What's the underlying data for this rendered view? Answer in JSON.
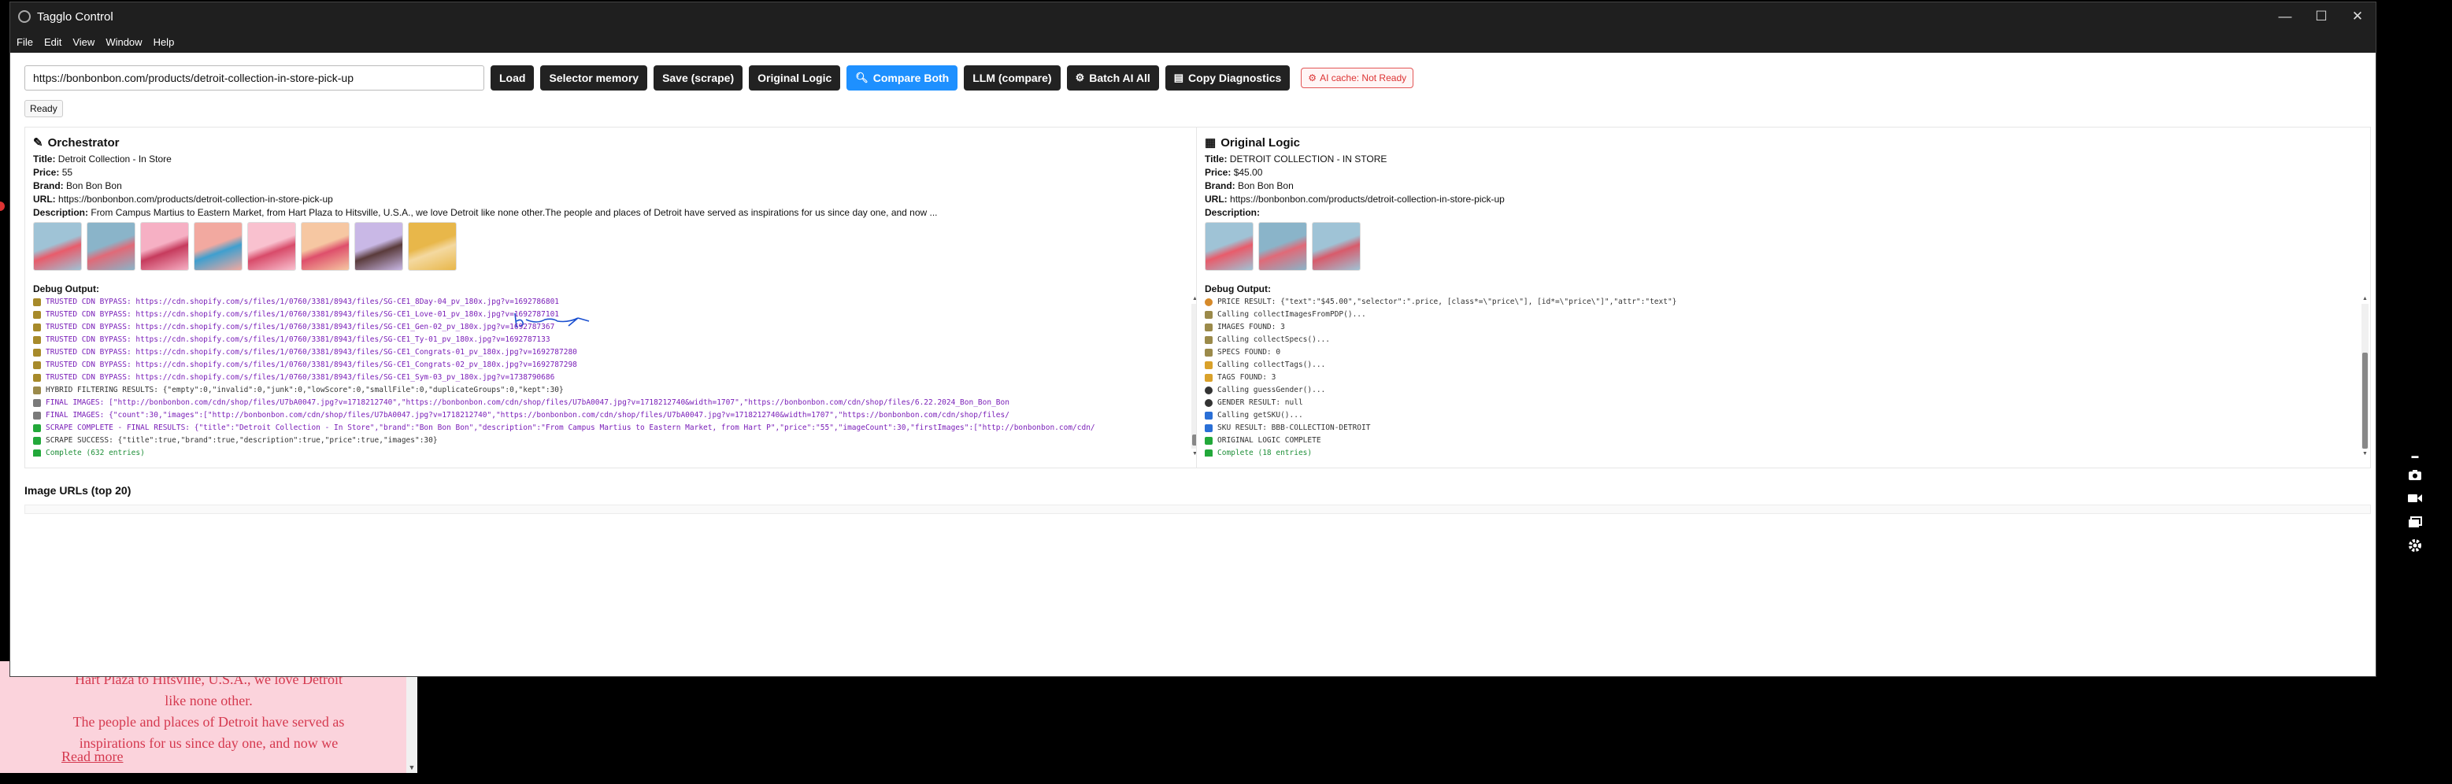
{
  "window": {
    "title": "Tagglo Control",
    "controls": {
      "minimize": "—",
      "maximize": "☐",
      "close": "✕"
    }
  },
  "menu": [
    "File",
    "Edit",
    "View",
    "Window",
    "Help"
  ],
  "toolbar": {
    "url_value": "https://bonbonbon.com/products/detroit-collection-in-store-pick-up",
    "buttons": {
      "load": "Load",
      "selector_memory": "Selector memory",
      "save_scrape": "Save (scrape)",
      "original_logic": "Original Logic",
      "compare_both": "Compare Both",
      "llm_compare": "LLM (compare)",
      "batch_ai_all": "Batch AI All",
      "copy_diagnostics": "Copy Diagnostics"
    },
    "ai_cache": "AI cache: Not Ready",
    "accent": "#1e90ff"
  },
  "status": "Ready",
  "left_panel": {
    "title": "Orchestrator",
    "fields": {
      "title_label": "Title:",
      "title": "Detroit Collection - In Store",
      "price_label": "Price:",
      "price": "55",
      "brand_label": "Brand:",
      "brand": "Bon Bon Bon",
      "url_label": "URL:",
      "url": "https://bonbonbon.com/products/detroit-collection-in-store-pick-up",
      "description_label": "Description:",
      "description": "From Campus Martius to Eastern Market, from Hart Plaza to Hitsville, U.S.A., we love Detroit like none other.The people and places of Detroit have served as inspirations for us since day one, and now ..."
    },
    "thumbnail_colors": [
      [
        "#9fc3d6",
        "#e85c6b"
      ],
      [
        "#8ab4c9",
        "#e06a78"
      ],
      [
        "#f6b0c4",
        "#c63b5d"
      ],
      [
        "#f2a9a0",
        "#3f9fcf"
      ],
      [
        "#f9c1cf",
        "#d84b6a"
      ],
      [
        "#f6c7a2",
        "#de4f6b"
      ],
      [
        "#c9b8e6",
        "#5a3b3b"
      ],
      [
        "#e8b74a",
        "#f4d9a0"
      ]
    ],
    "debug_label": "Debug Output:",
    "debug_lines": [
      {
        "icon": "lock",
        "style": "purple",
        "text": "TRUSTED CDN BYPASS: https://cdn.shopify.com/s/files/1/0760/3381/8943/files/SG-CE1_8Day-04_pv_180x.jpg?v=1692786801"
      },
      {
        "icon": "lock",
        "style": "purple",
        "text": "TRUSTED CDN BYPASS: https://cdn.shopify.com/s/files/1/0760/3381/8943/files/SG-CE1_Love-01_pv_180x.jpg?v=1692787101"
      },
      {
        "icon": "lock",
        "style": "purple",
        "text": "TRUSTED CDN BYPASS: https://cdn.shopify.com/s/files/1/0760/3381/8943/files/SG-CE1_Gen-02_pv_180x.jpg?v=1692787367"
      },
      {
        "icon": "lock",
        "style": "purple",
        "text": "TRUSTED CDN BYPASS: https://cdn.shopify.com/s/files/1/0760/3381/8943/files/SG-CE1_Ty-01_pv_180x.jpg?v=1692787133"
      },
      {
        "icon": "lock",
        "style": "purple",
        "text": "TRUSTED CDN BYPASS: https://cdn.shopify.com/s/files/1/0760/3381/8943/files/SG-CE1_Congrats-01_pv_180x.jpg?v=1692787280"
      },
      {
        "icon": "lock",
        "style": "purple",
        "text": "TRUSTED CDN BYPASS: https://cdn.shopify.com/s/files/1/0760/3381/8943/files/SG-CE1_Congrats-02_pv_180x.jpg?v=1692787298"
      },
      {
        "icon": "lock",
        "style": "purple",
        "text": "TRUSTED CDN BYPASS: https://cdn.shopify.com/s/files/1/0760/3381/8943/files/SG-CE1_Sym-03_pv_180x.jpg?v=1738790686"
      },
      {
        "icon": "hyb",
        "style": "dark",
        "text": "HYBRID FILTERING RESULTS: {\"empty\":0,\"invalid\":0,\"junk\":0,\"lowScore\":0,\"smallFile\":0,\"duplicateGroups\":0,\"kept\":30}"
      },
      {
        "icon": "fin",
        "style": "purple",
        "text": "FINAL IMAGES: [\"http://bonbonbon.com/cdn/shop/files/U7bA0047.jpg?v=1718212740\",\"https://bonbonbon.com/cdn/shop/files/U7bA0047.jpg?v=1718212740&width=1707\",\"https://bonbonbon.com/cdn/shop/files/6.22.2024_Bon_Bon_Bon"
      },
      {
        "icon": "fin",
        "style": "purple",
        "text": "FINAL IMAGES: {\"count\":30,\"images\":[\"http://bonbonbon.com/cdn/shop/files/U7bA0047.jpg?v=1718212740\",\"https://bonbonbon.com/cdn/shop/files/U7bA0047.jpg?v=1718212740&width=1707\",\"https://bonbonbon.com/cdn/shop/files/"
      },
      {
        "icon": "ok",
        "style": "purple",
        "text": "SCRAPE COMPLETE - FINAL RESULTS: {\"title\":\"Detroit Collection - In Store\",\"brand\":\"Bon Bon Bon\",\"description\":\"From Campus Martius to Eastern Market, from Hart P\",\"price\":\"55\",\"imageCount\":30,\"firstImages\":[\"http://bonbonbon.com/cdn/"
      },
      {
        "icon": "ok",
        "style": "dark",
        "text": "SCRAPE SUCCESS: {\"title\":true,\"brand\":true,\"description\":true,\"price\":true,\"images\":30}"
      },
      {
        "icon": "ok",
        "style": "green",
        "text": "Complete (632 entries)"
      }
    ]
  },
  "right_panel": {
    "title": "Original Logic",
    "fields": {
      "title_label": "Title:",
      "title": "DETROIT COLLECTION - IN STORE",
      "price_label": "Price:",
      "price": "$45.00",
      "brand_label": "Brand:",
      "brand": "Bon Bon Bon",
      "url_label": "URL:",
      "url": "https://bonbonbon.com/products/detroit-collection-in-store-pick-up",
      "description_label": "Description:",
      "description": ""
    },
    "thumbnail_colors": [
      [
        "#9fc3d6",
        "#e85c6b"
      ],
      [
        "#8ab4c9",
        "#e06a78"
      ],
      [
        "#9fc3d6",
        "#d85b6b"
      ]
    ],
    "debug_label": "Debug Output:",
    "debug_lines": [
      {
        "icon": "price",
        "style": "dark",
        "text": "PRICE RESULT: {\"text\":\"$45.00\",\"selector\":\".price, [class*=\\\"price\\\"], [id*=\\\"price\\\"]\",\"attr\":\"text\"}"
      },
      {
        "icon": "hyb",
        "style": "dark",
        "text": "Calling collectImagesFromPDP()..."
      },
      {
        "icon": "hyb",
        "style": "dark",
        "text": "IMAGES FOUND: 3"
      },
      {
        "icon": "hyb",
        "style": "dark",
        "text": "Calling collectSpecs()..."
      },
      {
        "icon": "hyb",
        "style": "dark",
        "text": "SPECS FOUND: 0"
      },
      {
        "icon": "tag",
        "style": "dark",
        "text": "Calling collectTags()..."
      },
      {
        "icon": "tag",
        "style": "dark",
        "text": "TAGS FOUND: 3"
      },
      {
        "icon": "person",
        "style": "dark",
        "text": "Calling guessGender()..."
      },
      {
        "icon": "person",
        "style": "dark",
        "text": "GENDER RESULT: null"
      },
      {
        "icon": "blue",
        "style": "dark",
        "text": "Calling getSKU()..."
      },
      {
        "icon": "blue",
        "style": "dark",
        "text": "SKU RESULT: BBB-COLLECTION-DETROIT"
      },
      {
        "icon": "ok",
        "style": "dark",
        "text": "ORIGINAL LOGIC COMPLETE"
      },
      {
        "icon": "ok",
        "style": "green",
        "text": "Complete (18 entries)"
      }
    ]
  },
  "image_urls_heading": "Image URLs (top 20)",
  "background_page": {
    "lines": [
      "Hart Plaza to Hitsville, U.S.A., we love Detroit",
      "like none other.",
      "The people and places of Detroit have served as",
      "inspirations for us since day one, and now we"
    ],
    "read_more": "Read more"
  }
}
